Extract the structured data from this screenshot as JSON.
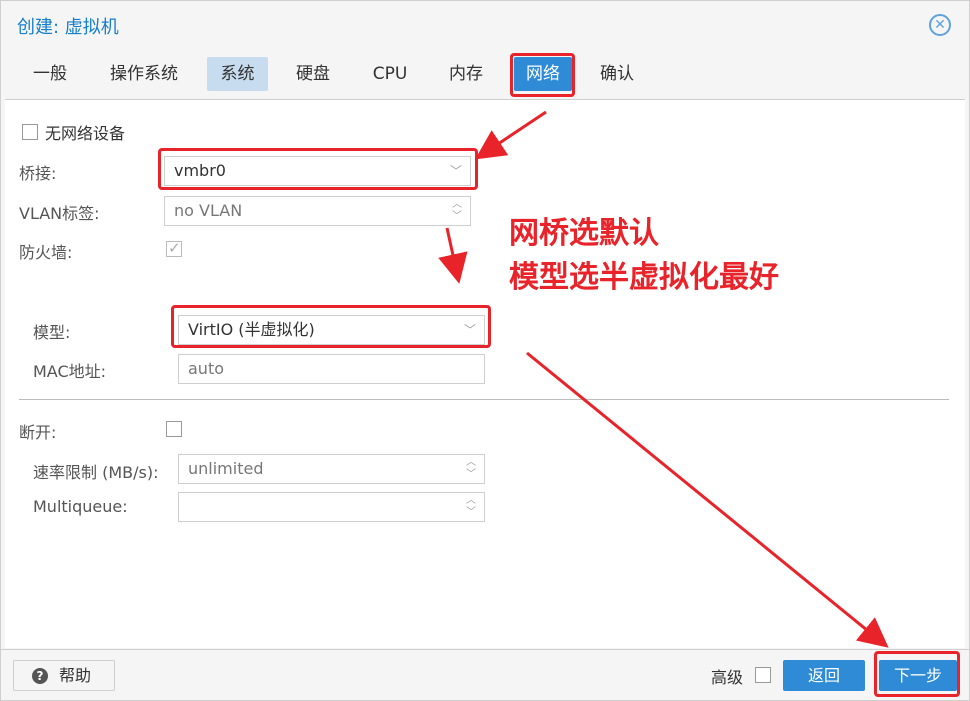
{
  "window": {
    "title": "创建: 虚拟机"
  },
  "tabs": [
    "一般",
    "操作系统",
    "系统",
    "硬盘",
    "CPU",
    "内存",
    "网络",
    "确认"
  ],
  "form": {
    "no_network_label": "无网络设备",
    "bridge_label": "桥接:",
    "bridge_value": "vmbr0",
    "vlan_label": "VLAN标签:",
    "vlan_value": "no VLAN",
    "firewall_label": "防火墙:",
    "model_label": "模型:",
    "model_value": "VirtIO (半虚拟化)",
    "mac_label": "MAC地址:",
    "mac_value": "auto",
    "disconnect_label": "断开:",
    "rate_label": "速率限制 (MB/s):",
    "rate_value": "unlimited",
    "multiqueue_label": "Multiqueue:",
    "multiqueue_value": ""
  },
  "annotation": {
    "line1": "网桥选默认",
    "line2": "模型选半虚拟化最好"
  },
  "footer": {
    "help_label": "帮助",
    "advanced_label": "高级",
    "back_label": "返回",
    "next_label": "下一步"
  },
  "colors": {
    "accent": "#2f8bd6",
    "highlight": "#e8232a"
  }
}
